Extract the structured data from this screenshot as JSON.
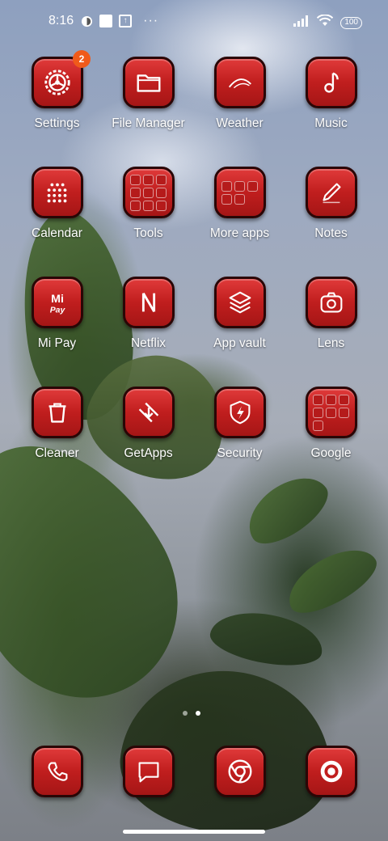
{
  "status_bar": {
    "time": "8:16",
    "battery": "100",
    "overflow": "···"
  },
  "apps": [
    {
      "label": "Settings",
      "icon": "gear-icon",
      "badge": "2"
    },
    {
      "label": "File Manager",
      "icon": "folder-icon"
    },
    {
      "label": "Weather",
      "icon": "weather-arc-icon"
    },
    {
      "label": "Music",
      "icon": "music-note-icon"
    },
    {
      "label": "Calendar",
      "icon": "calendar-icon"
    },
    {
      "label": "Tools",
      "icon": "folder-grid-icon"
    },
    {
      "label": "More apps",
      "icon": "folder-grid-icon"
    },
    {
      "label": "Notes",
      "icon": "notes-pen-icon"
    },
    {
      "label": "Mi Pay",
      "icon": "mi-pay-icon",
      "icon_text": "Mi Pay"
    },
    {
      "label": "Netflix",
      "icon": "netflix-icon",
      "icon_text": "N"
    },
    {
      "label": "App vault",
      "icon": "layers-icon"
    },
    {
      "label": "Lens",
      "icon": "lens-camera-icon"
    },
    {
      "label": "Cleaner",
      "icon": "trash-icon"
    },
    {
      "label": "GetApps",
      "icon": "getapps-icon"
    },
    {
      "label": "Security",
      "icon": "shield-bolt-icon"
    },
    {
      "label": "Google",
      "icon": "folder-grid-icon"
    }
  ],
  "dock": [
    {
      "icon": "phone-icon"
    },
    {
      "icon": "message-icon"
    },
    {
      "icon": "chrome-icon"
    },
    {
      "icon": "camera-icon"
    }
  ],
  "colors": {
    "icon_red": "#c01e1e",
    "badge_orange": "#f05a1a"
  }
}
